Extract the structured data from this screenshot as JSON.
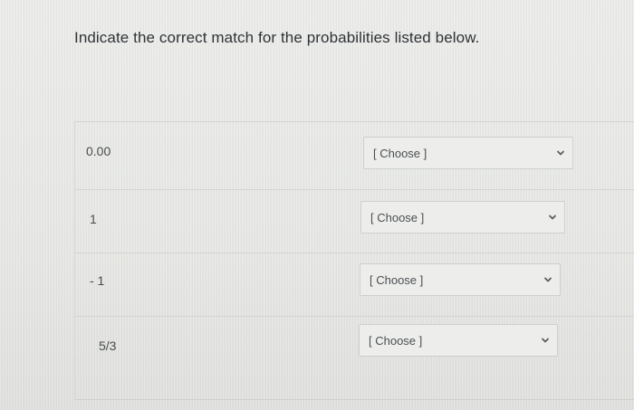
{
  "question": {
    "text": "Indicate the correct match for the probabilities listed below."
  },
  "rows": [
    {
      "label": "0.00",
      "select_value": "[ Choose ]"
    },
    {
      "label": "1",
      "select_value": "[ Choose ]"
    },
    {
      "label": "- 1",
      "select_value": "[ Choose ]"
    },
    {
      "label": "5/3",
      "select_value": "[ Choose ]"
    }
  ],
  "icons": {
    "dropdown": "chevron-down-icon"
  },
  "colors": {
    "background": "#e6e7e4",
    "text": "#3a3d40",
    "border": "#cdd0cd"
  }
}
